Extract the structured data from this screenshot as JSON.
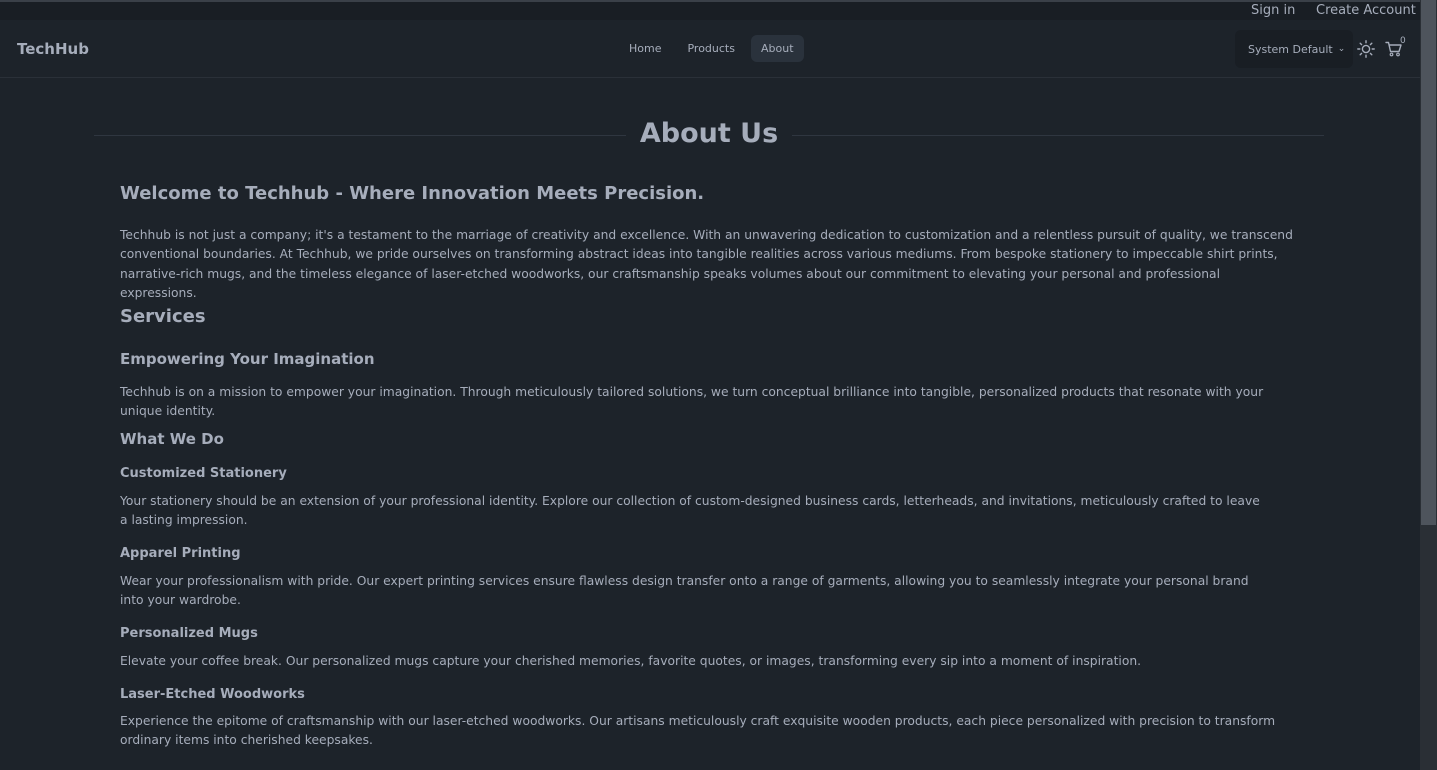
{
  "topbar": {
    "sign_in": "Sign in",
    "create_account": "Create Account ?"
  },
  "navbar": {
    "brand": "TechHub",
    "links": [
      {
        "label": "Home"
      },
      {
        "label": "Products"
      },
      {
        "label": "About",
        "active": true
      }
    ],
    "theme_select": "System Default",
    "cart_count": "0",
    "icons": [
      "chevron-down-icon",
      "sun-icon",
      "cart-icon"
    ]
  },
  "page": {
    "title": "About Us",
    "welcome_heading": "Welcome to Techhub - Where Innovation Meets Precision.",
    "intro": "Techhub is not just a company; it's a testament to the marriage of creativity and excellence. With an unwavering dedication to customization and a relentless pursuit of quality, we transcend conventional boundaries. At Techhub, we pride ourselves on transforming abstract ideas into tangible realities across various mediums. From bespoke stationery to impeccable shirt prints, narrative-rich mugs, and the timeless elegance of laser-etched woodworks, our craftsmanship speaks volumes about our commitment to elevating your personal and professional expressions.",
    "services_heading": "Services",
    "empower_heading": "Empowering Your Imagination",
    "empower_text": "Techhub is on a mission to empower your imagination. Through meticulously tailored solutions, we turn conceptual brilliance into tangible, personalized products that resonate with your unique identity.",
    "what_we_do_heading": "What We Do",
    "items": [
      {
        "title": "Customized Stationery",
        "text": "Your stationery should be an extension of your professional identity. Explore our collection of custom-designed business cards, letterheads, and invitations, meticulously crafted to leave a lasting impression."
      },
      {
        "title": "Apparel Printing",
        "text": "Wear your professionalism with pride. Our expert printing services ensure flawless design transfer onto a range of garments, allowing you to seamlessly integrate your personal brand into your wardrobe."
      },
      {
        "title": "Personalized Mugs",
        "text": "Elevate your coffee break. Our personalized mugs capture your cherished memories, favorite quotes, or images, transforming every sip into a moment of inspiration."
      },
      {
        "title": "Laser-Etched Woodworks",
        "text": "Experience the epitome of craftsmanship with our laser-etched woodworks. Our artisans meticulously craft exquisite wooden products, each piece personalized with precision to transform ordinary items into cherished keepsakes."
      }
    ]
  }
}
